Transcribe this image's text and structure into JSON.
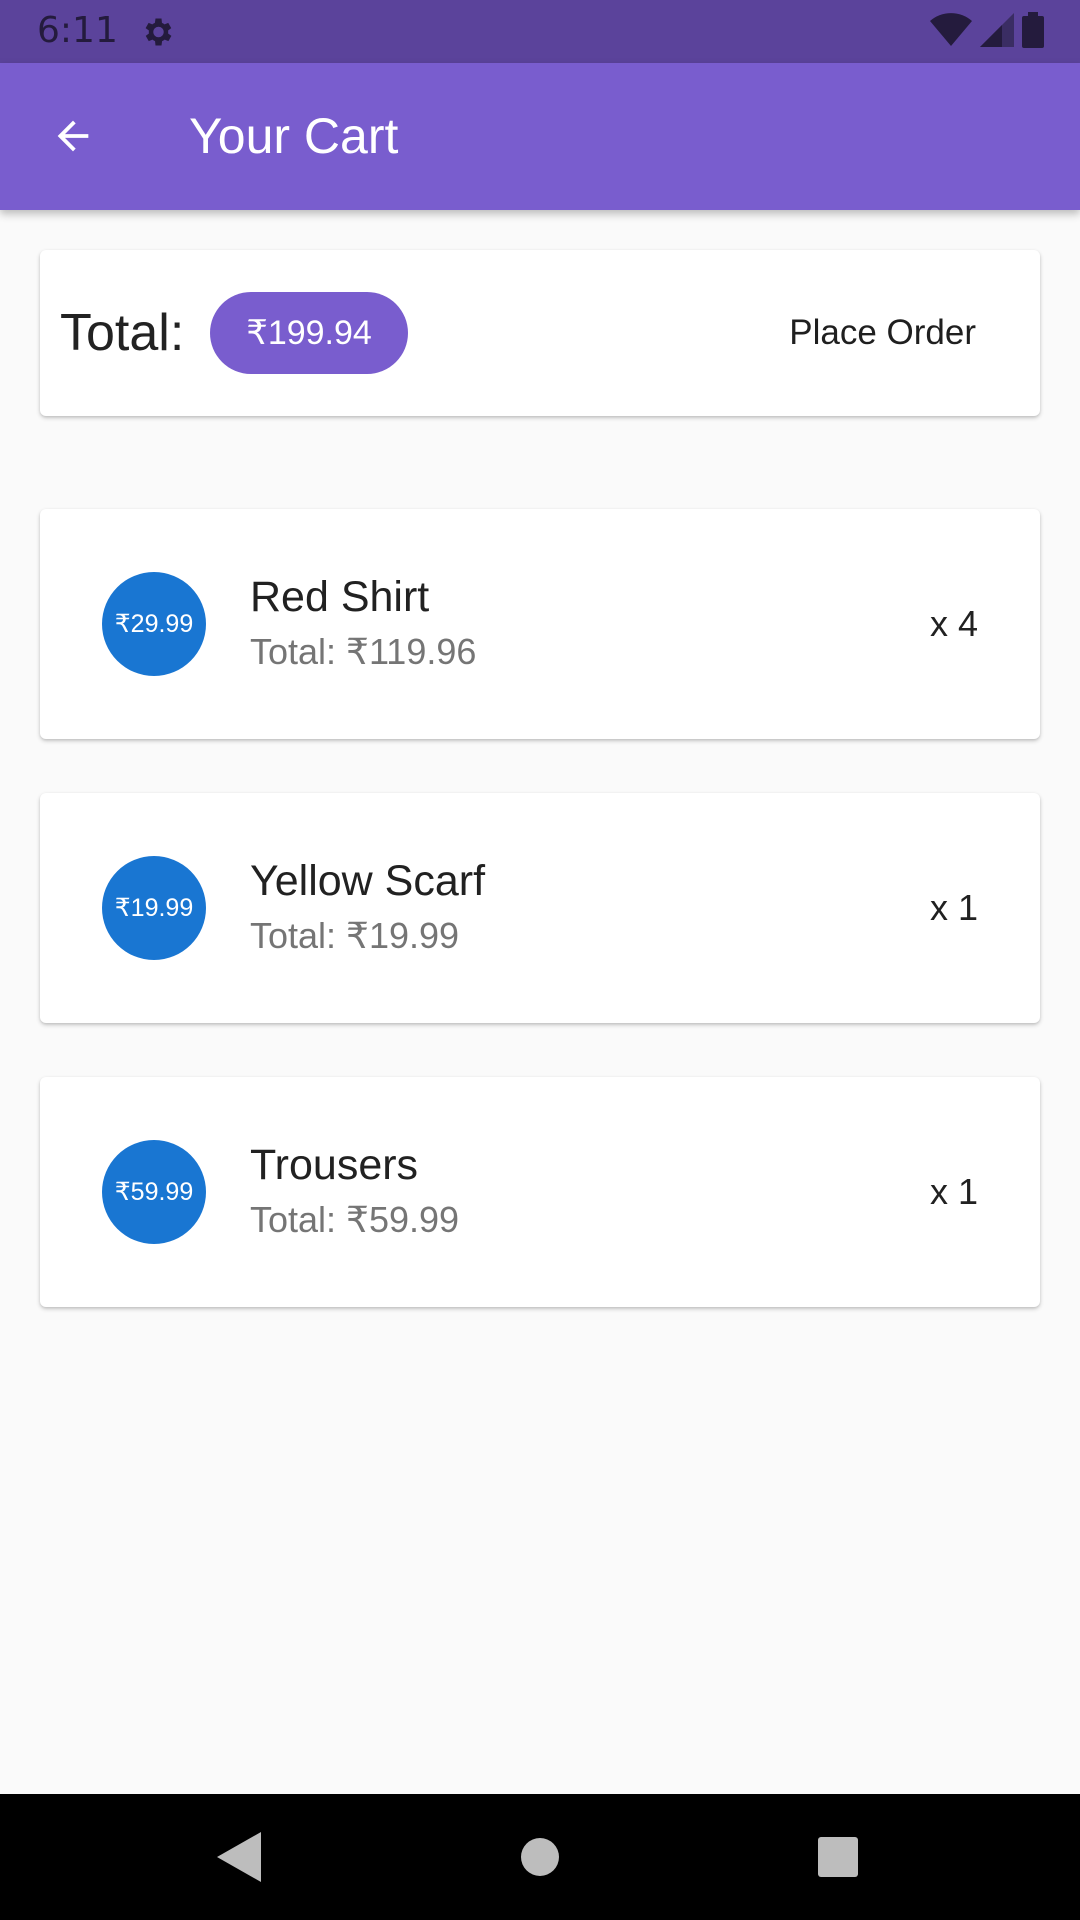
{
  "status_bar": {
    "time": "6:11",
    "settings_icon": "gear-icon",
    "wifi_icon": "wifi-icon",
    "signal_icon": "signal-icon",
    "battery_icon": "battery-icon"
  },
  "app_bar": {
    "back_icon": "arrow-back-icon",
    "title": "Your Cart"
  },
  "summary": {
    "total_label": "Total:",
    "total_amount": "₹199.94",
    "place_order_label": "Place Order"
  },
  "items": [
    {
      "price": "₹29.99",
      "name": "Red Shirt",
      "subtotal": "Total: ₹119.96",
      "qty": "x 4"
    },
    {
      "price": "₹19.99",
      "name": "Yellow Scarf",
      "subtotal": "Total: ₹19.99",
      "qty": "x 1"
    },
    {
      "price": "₹59.99",
      "name": "Trousers",
      "subtotal": "Total: ₹59.99",
      "qty": "x 1"
    }
  ],
  "nav_bar": {
    "back_icon": "nav-back-icon",
    "home_icon": "nav-home-icon",
    "recents_icon": "nav-recents-icon"
  },
  "colors": {
    "status_bar": "#5b439b",
    "app_bar": "#795dce",
    "chip": "#795dce",
    "price_circle": "#1976d2",
    "background": "#fafafa"
  }
}
